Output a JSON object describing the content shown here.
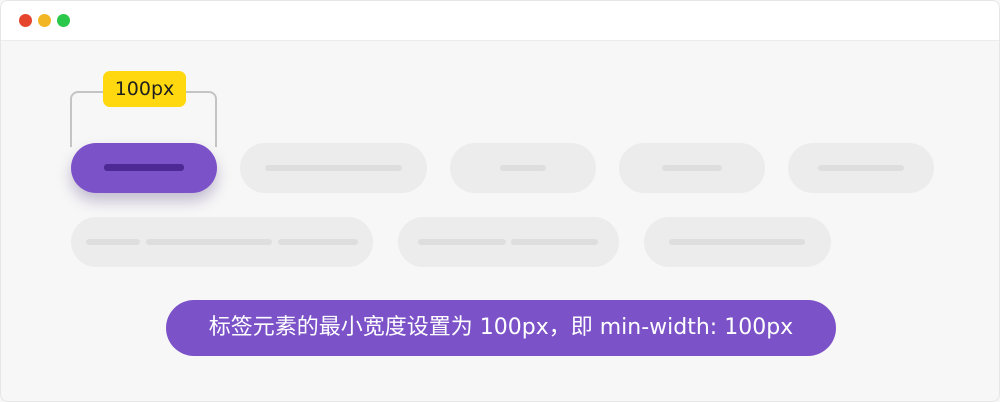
{
  "window": {
    "controls": [
      "close",
      "minimize",
      "maximize"
    ]
  },
  "demo": {
    "width_label": "100px",
    "caption": "标签元素的最小宽度设置为 100px，即 min-width: 100px"
  },
  "colors": {
    "accent": "#7c52c8",
    "accent_dark": "#4c2994",
    "label_bg": "#ffd80f",
    "placeholder": "#ececec"
  }
}
